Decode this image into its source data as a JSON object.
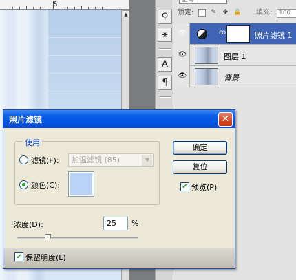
{
  "ruler": {
    "mark": "5"
  },
  "tools": {
    "items": [
      "stamp-tool",
      "stamp-tool-2",
      "type-tool",
      "paragraph-tool"
    ]
  },
  "layers_panel": {
    "blend_mode": "正常",
    "lock_label": "锁定:",
    "fill_label": "填充:",
    "fill_value": "100",
    "layers": [
      {
        "name": "照片滤镜 1",
        "selected": true,
        "kind": "adjustment"
      },
      {
        "name": "图层 1",
        "selected": false,
        "kind": "layer"
      },
      {
        "name": "背景",
        "selected": false,
        "kind": "background"
      }
    ]
  },
  "dialog": {
    "title": "照片滤镜",
    "close_glyph": "✕",
    "group_label": "使用",
    "filter_radio": {
      "label": "滤镜(",
      "key": "F",
      "suffix": "):",
      "selected": false
    },
    "filter_select": {
      "value": "加温滤镜 (85)",
      "disabled": true
    },
    "color_radio": {
      "label": "颜色(",
      "key": "C",
      "suffix": "):",
      "selected": true
    },
    "color_swatch": "#b9d3f7",
    "buttons": {
      "ok": "确定",
      "reset": "复位"
    },
    "preview": {
      "label": "预览(",
      "key": "P",
      "suffix": ")",
      "checked": true
    },
    "density": {
      "label": "浓度(",
      "key": "D",
      "suffix": "):",
      "value": "25",
      "unit": "%",
      "percent": 25
    },
    "preserve": {
      "label": "保留明度(",
      "key": "L",
      "suffix": ")",
      "checked": true
    }
  },
  "colors": {
    "title_bar": "#0054e3",
    "selected_layer": "#3f64b5",
    "dialog_bg": "#ece9d8"
  }
}
